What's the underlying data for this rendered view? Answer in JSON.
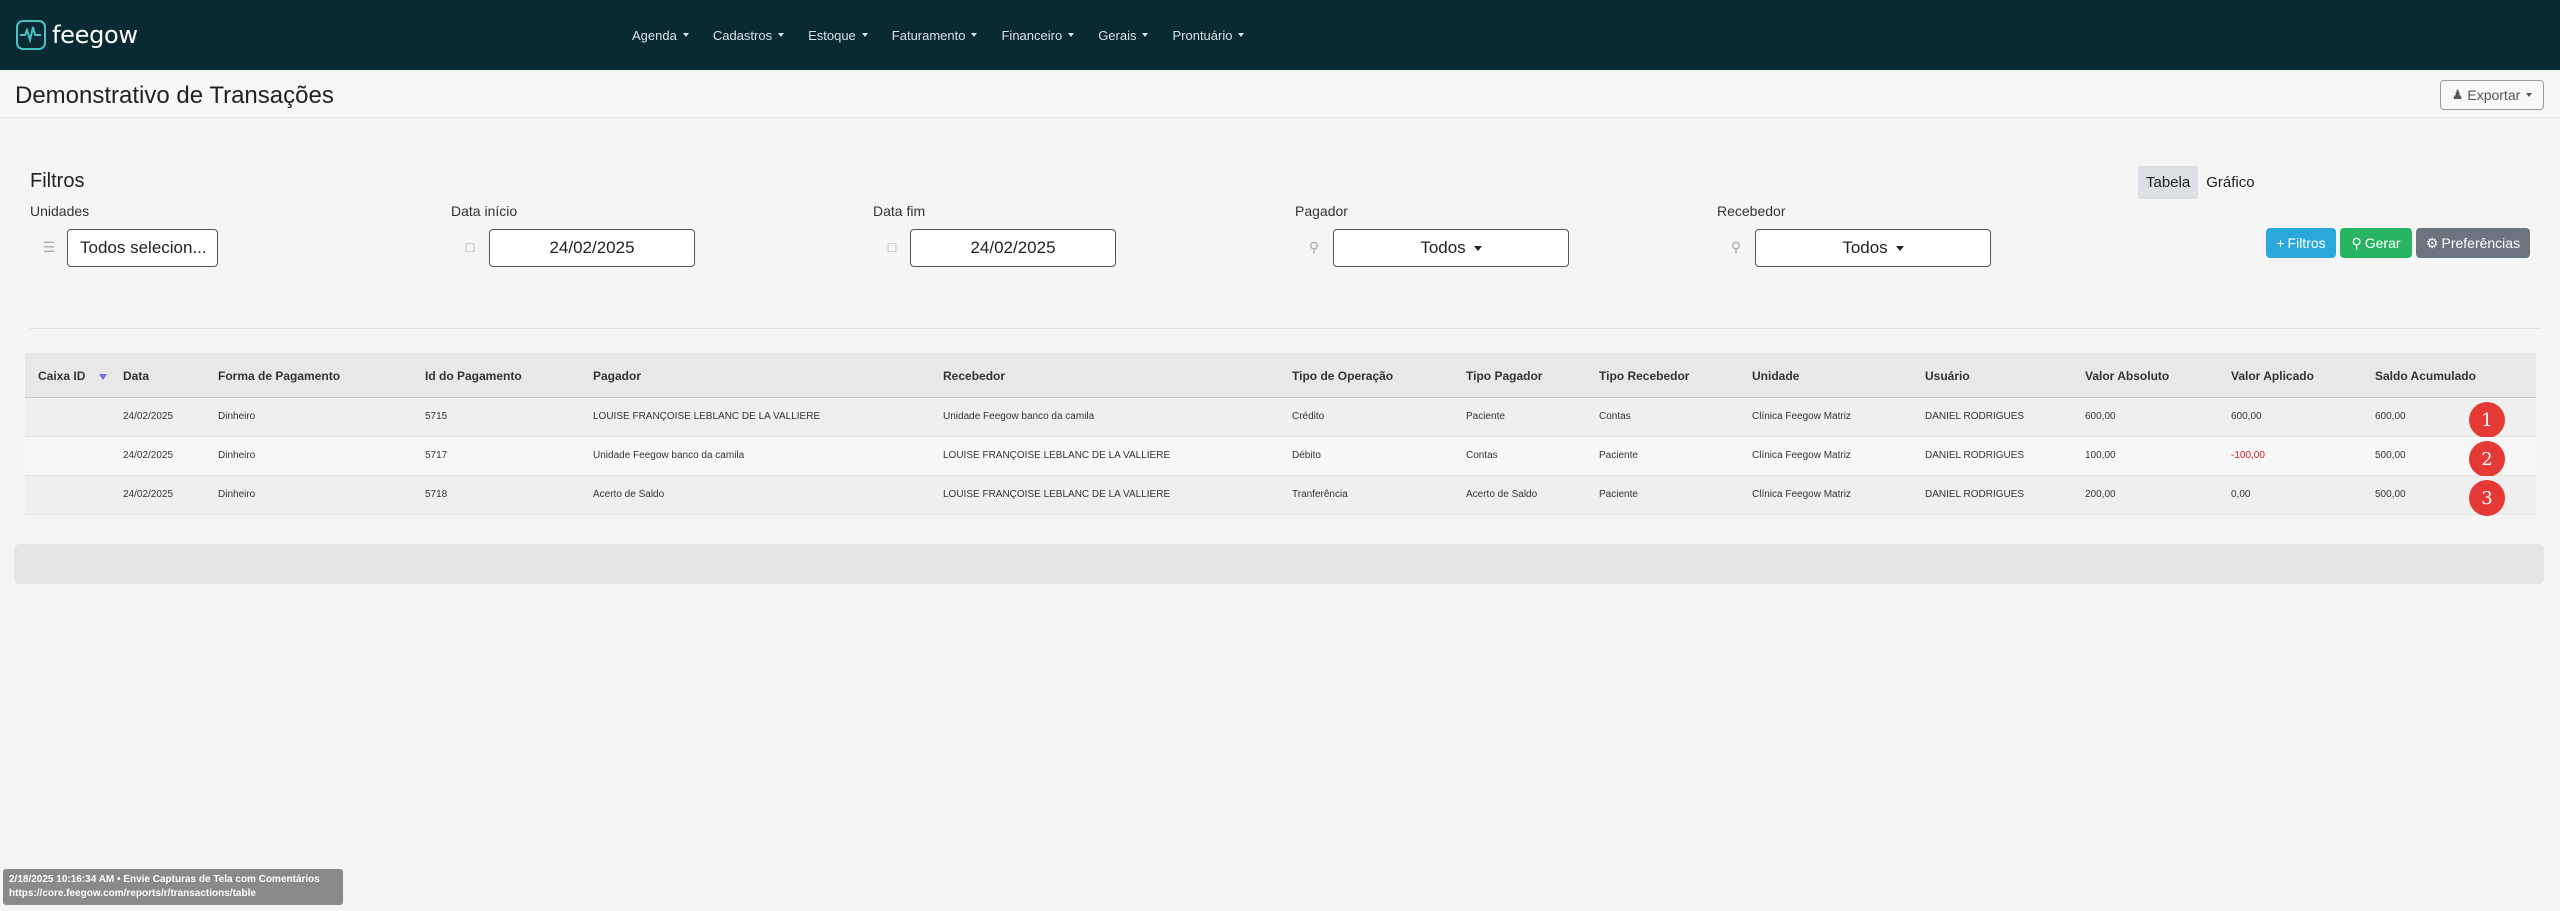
{
  "app": {
    "name": "feegow",
    "accent": "#49c1c1",
    "navbar_color": "#0a2a33"
  },
  "nav": {
    "items": [
      "Agenda",
      "Cadastros",
      "Estoque",
      "Faturamento",
      "Financeiro",
      "Gerais",
      "Prontuário"
    ]
  },
  "header": {
    "title": "Demonstrativo de Transações",
    "export_label": "Exportar"
  },
  "filters": {
    "title": "Filtros",
    "view_tabs": [
      "Tabela",
      "Gráfico"
    ],
    "active_view": "Tabela",
    "unidades": {
      "label": "Unidades",
      "value": "Todos selecion..."
    },
    "data_inicio": {
      "label": "Data início",
      "value": "24/02/2025"
    },
    "data_fim": {
      "label": "Data fim",
      "value": "24/02/2025"
    },
    "pagador": {
      "label": "Pagador",
      "value": "Todos"
    },
    "recebedor": {
      "label": "Recebedor",
      "value": "Todos"
    },
    "buttons": {
      "filtros": "Filtros",
      "gerar": "Gerar",
      "preferencias": "Preferências"
    }
  },
  "table": {
    "columns": [
      "Caixa ID",
      "Data",
      "Forma de Pagamento",
      "Id do Pagamento",
      "Pagador",
      "Recebedor",
      "Tipo de Operação",
      "Tipo Pagador",
      "Tipo Recebedor",
      "Unidade",
      "Usuário",
      "Valor Absoluto",
      "Valor Aplicado",
      "Saldo Acumulado"
    ],
    "rows": [
      [
        "",
        "24/02/2025",
        "Dinheiro",
        "5715",
        "LOUISE FRANÇOISE LEBLANC DE LA VALLIERE",
        "Unidade Feegow banco da camila",
        "Crédito",
        "Paciente",
        "Contas",
        "Clínica Feegow Matriz",
        "DANIEL RODRIGUES",
        "600,00",
        "600,00",
        "600,00"
      ],
      [
        "",
        "24/02/2025",
        "Dinheiro",
        "5717",
        "Unidade Feegow banco da camila",
        "LOUISE FRANÇOISE LEBLANC DE LA VALLIERE",
        "Débito",
        "Contas",
        "Paciente",
        "Clínica Feegow Matriz",
        "DANIEL RODRIGUES",
        "100,00",
        "-100,00",
        "500,00"
      ],
      [
        "",
        "24/02/2025",
        "Dinheiro",
        "5718",
        "Acerto de Saldo",
        "LOUISE FRANÇOISE LEBLANC DE LA VALLIERE",
        "Tranferência",
        "Acerto de Saldo",
        "Paciente",
        "Clínica Feegow Matriz",
        "DANIEL RODRIGUES",
        "200,00",
        "0,00",
        "500,00"
      ]
    ],
    "row_badges": [
      "1",
      "2",
      "3"
    ],
    "negative_color": "#d02020"
  },
  "capture_note": {
    "line1": "2/18/2025 10:16:34 AM • Envie Capturas de Tela com Comentários",
    "line2": "https://core.feegow.com/reports/r/transactions/table"
  }
}
